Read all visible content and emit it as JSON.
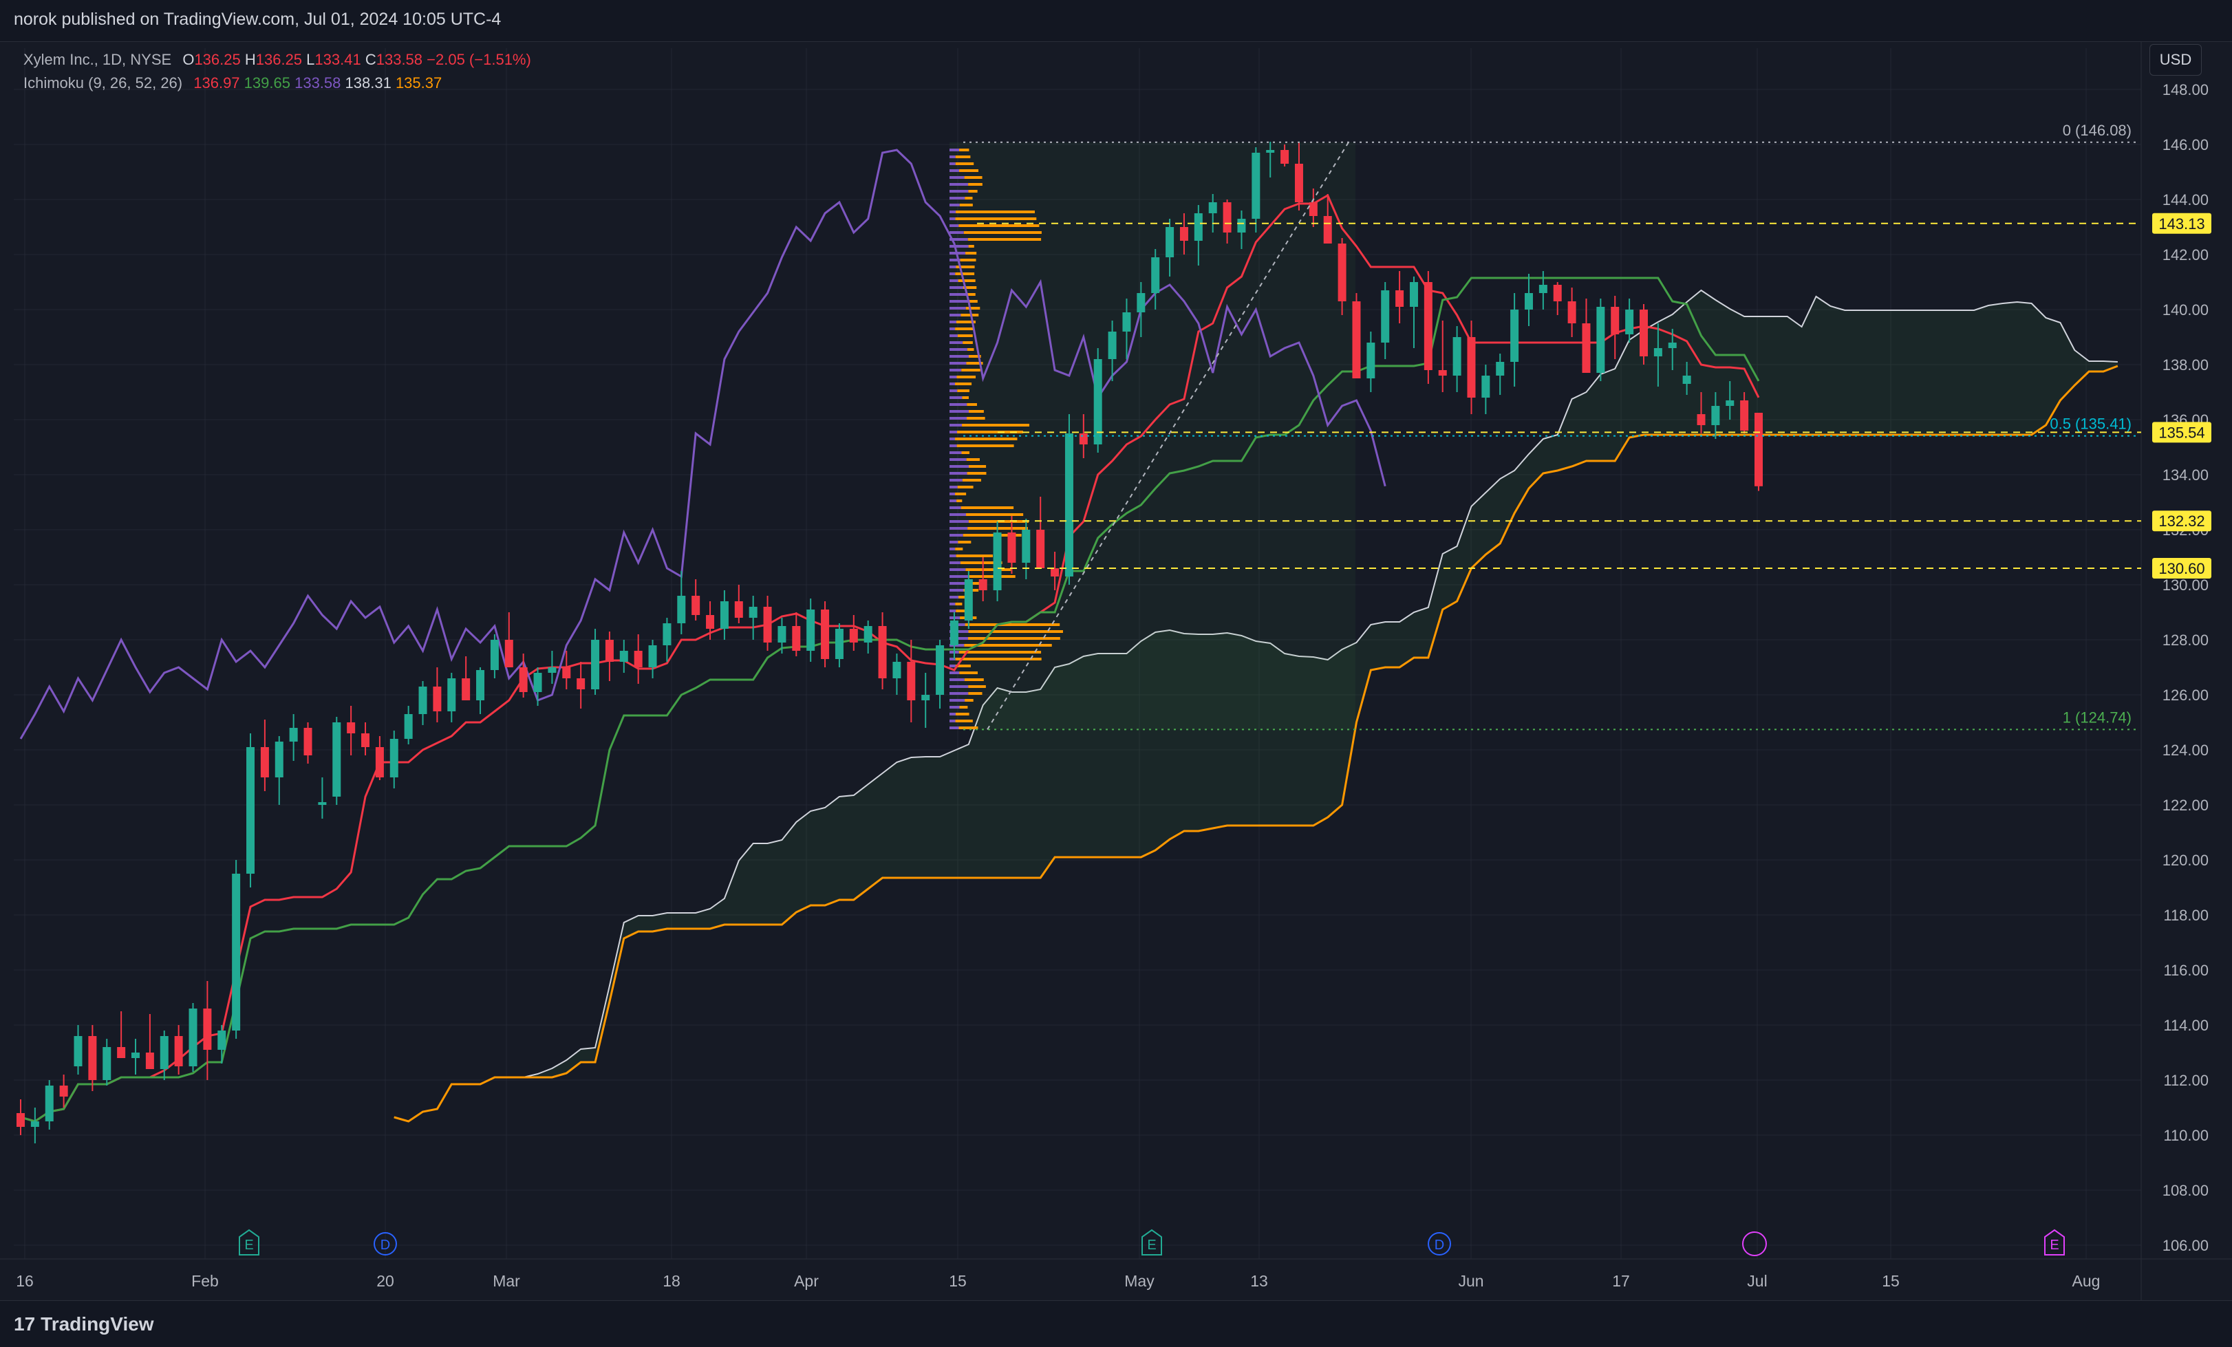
{
  "header": {
    "published": "norok published on TradingView.com, Jul 01, 2024 10:05 UTC-4"
  },
  "legend": {
    "symbol": "Xylem Inc., 1D, NYSE",
    "open_label": "O",
    "open": "136.25",
    "high_label": "H",
    "high": "136.25",
    "low_label": "L",
    "low": "133.41",
    "close_label": "C",
    "close": "133.58",
    "change": "−2.05 (−1.51%)",
    "indicator": "Ichimoku (9, 26, 52, 26)",
    "ind_values": [
      "136.97",
      "139.65",
      "133.58",
      "138.31",
      "135.37"
    ]
  },
  "currency": "USD",
  "footer": {
    "brand": "TradingView"
  },
  "colors": {
    "bull": "#22ab94",
    "bear": "#f23645",
    "tenkan": "#f23645",
    "kijun": "#43a047",
    "chikou": "#7e57c2",
    "spanA": "#d1d4dc",
    "spanB": "#ff9800",
    "level": "#ffeb3b"
  },
  "chart_data": {
    "type": "candlestick",
    "y_axis_ticks": [
      "148.00",
      "146.00",
      "144.00",
      "142.00",
      "140.00",
      "138.00",
      "136.00",
      "134.00",
      "132.00",
      "130.00",
      "128.00",
      "126.00",
      "124.00",
      "122.00",
      "120.00",
      "118.00",
      "116.00",
      "114.00",
      "112.00",
      "110.00",
      "108.00",
      "106.00"
    ],
    "ylim": [
      105.5,
      149.5
    ],
    "x_axis_ticks": [
      "16",
      "Feb",
      "20",
      "Mar",
      "18",
      "Apr",
      "15",
      "May",
      "13",
      "Jun",
      "17",
      "Jul",
      "15",
      "Aug"
    ],
    "price_levels": [
      {
        "value": 143.13,
        "label": "143.13"
      },
      {
        "value": 135.54,
        "label": "135.54"
      },
      {
        "value": 132.32,
        "label": "132.32"
      },
      {
        "value": 130.6,
        "label": "130.60"
      }
    ],
    "fib": [
      {
        "value": 146.08,
        "label": "0 (146.08)"
      },
      {
        "value": 135.41,
        "label": "0.5 (135.41)"
      },
      {
        "value": 124.74,
        "label": "1 (124.74)"
      }
    ],
    "events": [
      {
        "type": "E",
        "date": "Feb"
      },
      {
        "type": "D",
        "date": "20"
      },
      {
        "type": "E",
        "date": "May"
      },
      {
        "type": "D",
        "date": "Jun"
      },
      {
        "type": "split",
        "date": "Jul"
      },
      {
        "type": "E",
        "date": "Aug"
      }
    ],
    "candles": [
      [
        110.8,
        111.3,
        110.0,
        110.3
      ],
      [
        110.3,
        111.0,
        109.7,
        110.5
      ],
      [
        110.5,
        112.0,
        110.2,
        111.8
      ],
      [
        111.8,
        112.2,
        111.0,
        111.4
      ],
      [
        112.5,
        114.0,
        112.2,
        113.6
      ],
      [
        113.6,
        114.0,
        111.6,
        112.0
      ],
      [
        112.0,
        113.5,
        111.8,
        113.2
      ],
      [
        113.2,
        114.5,
        112.8,
        112.8
      ],
      [
        112.8,
        113.5,
        112.2,
        113.0
      ],
      [
        113.0,
        114.4,
        112.6,
        112.4
      ],
      [
        112.4,
        113.8,
        112.0,
        113.6
      ],
      [
        113.6,
        114.0,
        112.2,
        112.5
      ],
      [
        112.5,
        114.8,
        112.3,
        114.6
      ],
      [
        114.6,
        115.6,
        112.0,
        113.1
      ],
      [
        113.1,
        114.0,
        112.6,
        113.8
      ],
      [
        113.8,
        120.0,
        113.5,
        119.5
      ],
      [
        119.5,
        124.6,
        119.0,
        124.1
      ],
      [
        124.1,
        125.1,
        122.5,
        123.0
      ],
      [
        123.0,
        124.5,
        122.0,
        124.3
      ],
      [
        124.3,
        125.3,
        123.6,
        124.8
      ],
      [
        124.8,
        125.0,
        123.5,
        123.8
      ],
      [
        122.0,
        123.0,
        121.5,
        122.1
      ],
      [
        122.3,
        125.2,
        122.0,
        125.0
      ],
      [
        125.0,
        125.6,
        123.8,
        124.6
      ],
      [
        124.6,
        125.0,
        123.8,
        124.1
      ],
      [
        124.1,
        124.5,
        122.9,
        123.0
      ],
      [
        123.0,
        124.7,
        122.6,
        124.4
      ],
      [
        124.4,
        125.6,
        124.2,
        125.3
      ],
      [
        125.3,
        126.5,
        124.9,
        126.3
      ],
      [
        126.3,
        127.0,
        125.0,
        125.4
      ],
      [
        125.4,
        126.8,
        125.0,
        126.6
      ],
      [
        126.6,
        127.4,
        126.2,
        125.8
      ],
      [
        125.8,
        127.0,
        125.3,
        126.9
      ],
      [
        126.9,
        128.2,
        126.6,
        128.0
      ],
      [
        128.0,
        129.0,
        127.2,
        127.0
      ],
      [
        127.0,
        127.5,
        125.9,
        126.1
      ],
      [
        126.1,
        127.0,
        125.6,
        126.8
      ],
      [
        126.8,
        127.6,
        126.4,
        127.0
      ],
      [
        127.0,
        127.6,
        126.2,
        126.6
      ],
      [
        126.6,
        127.2,
        125.5,
        126.2
      ],
      [
        126.2,
        128.4,
        126.0,
        128.0
      ],
      [
        128.0,
        128.3,
        126.5,
        127.2
      ],
      [
        127.2,
        128.0,
        126.8,
        127.6
      ],
      [
        127.6,
        128.2,
        126.4,
        127.0
      ],
      [
        127.0,
        128.0,
        126.6,
        127.8
      ],
      [
        127.8,
        128.8,
        127.2,
        128.6
      ],
      [
        128.6,
        130.5,
        128.2,
        129.6
      ],
      [
        129.6,
        130.2,
        128.7,
        128.9
      ],
      [
        128.9,
        129.4,
        128.0,
        128.4
      ],
      [
        128.4,
        129.8,
        128.0,
        129.4
      ],
      [
        129.4,
        130.0,
        128.6,
        128.8
      ],
      [
        128.8,
        129.6,
        128.0,
        129.2
      ],
      [
        129.2,
        129.6,
        127.6,
        127.9
      ],
      [
        127.9,
        128.8,
        127.5,
        128.5
      ],
      [
        128.5,
        129.0,
        127.4,
        127.6
      ],
      [
        127.6,
        129.5,
        127.2,
        129.1
      ],
      [
        129.1,
        129.4,
        127.0,
        127.3
      ],
      [
        127.3,
        128.6,
        127.0,
        128.4
      ],
      [
        128.4,
        128.9,
        127.6,
        127.9
      ],
      [
        127.9,
        128.7,
        127.5,
        128.5
      ],
      [
        128.5,
        129.0,
        126.2,
        126.6
      ],
      [
        126.6,
        127.5,
        126.0,
        127.2
      ],
      [
        127.2,
        128.0,
        125.0,
        125.8
      ],
      [
        125.8,
        126.8,
        124.8,
        126.0
      ],
      [
        126.0,
        128.0,
        125.5,
        127.8
      ],
      [
        127.8,
        129.0,
        127.3,
        128.7
      ],
      [
        128.7,
        130.5,
        128.4,
        130.2
      ],
      [
        130.2,
        131.0,
        129.4,
        129.8
      ],
      [
        129.8,
        132.3,
        129.4,
        131.9
      ],
      [
        131.9,
        132.5,
        130.4,
        130.8
      ],
      [
        130.8,
        132.4,
        130.2,
        132.0
      ],
      [
        132.0,
        133.2,
        131.1,
        130.6
      ],
      [
        130.6,
        131.2,
        129.8,
        130.3
      ],
      [
        130.3,
        136.2,
        130.0,
        135.5
      ],
      [
        135.5,
        136.2,
        134.6,
        135.1
      ],
      [
        135.1,
        138.6,
        134.8,
        138.2
      ],
      [
        138.2,
        139.6,
        137.4,
        139.2
      ],
      [
        139.2,
        140.4,
        138.2,
        139.9
      ],
      [
        139.9,
        141.0,
        139.0,
        140.6
      ],
      [
        140.6,
        142.2,
        140.0,
        141.9
      ],
      [
        141.9,
        143.3,
        141.2,
        143.0
      ],
      [
        143.0,
        143.5,
        142.0,
        142.5
      ],
      [
        142.5,
        143.8,
        141.6,
        143.5
      ],
      [
        143.5,
        144.2,
        142.8,
        143.9
      ],
      [
        143.9,
        144.0,
        142.4,
        142.8
      ],
      [
        142.8,
        143.6,
        142.2,
        143.3
      ],
      [
        143.3,
        145.9,
        142.8,
        145.7
      ],
      [
        145.7,
        146.1,
        144.8,
        145.8
      ],
      [
        145.8,
        146.0,
        145.2,
        145.3
      ],
      [
        145.3,
        146.1,
        143.6,
        143.9
      ],
      [
        143.9,
        144.4,
        143.0,
        143.4
      ],
      [
        143.4,
        144.2,
        142.5,
        142.4
      ],
      [
        142.4,
        142.6,
        139.8,
        140.3
      ],
      [
        140.3,
        140.6,
        138.5,
        137.5
      ],
      [
        137.5,
        139.2,
        137.0,
        138.8
      ],
      [
        138.8,
        141.0,
        138.2,
        140.7
      ],
      [
        140.7,
        141.4,
        139.5,
        140.1
      ],
      [
        140.1,
        141.2,
        138.6,
        141.0
      ],
      [
        141.0,
        141.4,
        137.3,
        137.8
      ],
      [
        137.8,
        139.6,
        137.0,
        137.6
      ],
      [
        137.6,
        139.4,
        137.0,
        139.0
      ],
      [
        139.0,
        139.6,
        136.2,
        136.8
      ],
      [
        136.8,
        138.0,
        136.2,
        137.6
      ],
      [
        137.6,
        138.4,
        136.9,
        138.1
      ],
      [
        138.1,
        140.6,
        137.2,
        140.0
      ],
      [
        140.0,
        141.3,
        139.4,
        140.6
      ],
      [
        140.6,
        141.4,
        140.0,
        140.9
      ],
      [
        140.9,
        141.0,
        139.8,
        140.3
      ],
      [
        140.3,
        140.8,
        139.0,
        139.5
      ],
      [
        139.5,
        140.4,
        138.5,
        137.7
      ],
      [
        137.7,
        140.4,
        137.4,
        140.1
      ],
      [
        140.1,
        140.5,
        138.2,
        139.1
      ],
      [
        139.1,
        140.4,
        138.8,
        140.0
      ],
      [
        140.0,
        140.2,
        138.0,
        138.3
      ],
      [
        138.3,
        139.5,
        137.2,
        138.6
      ],
      [
        138.6,
        139.3,
        137.8,
        138.8
      ],
      [
        137.3,
        138.1,
        136.9,
        137.6
      ],
      [
        136.2,
        137.0,
        135.5,
        135.8
      ],
      [
        135.8,
        137.0,
        135.3,
        136.5
      ],
      [
        136.5,
        137.4,
        136.0,
        136.7
      ],
      [
        136.7,
        137.0,
        135.5,
        135.6
      ],
      [
        136.25,
        136.25,
        133.41,
        133.58
      ]
    ]
  }
}
